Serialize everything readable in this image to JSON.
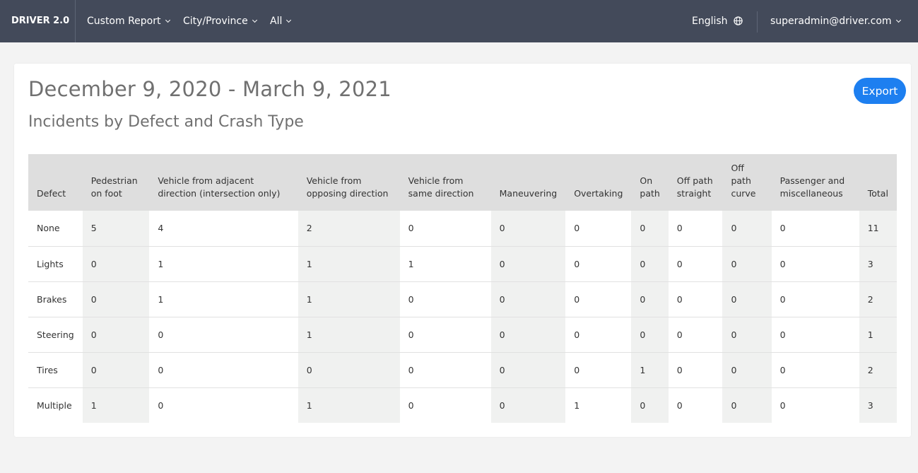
{
  "nav": {
    "brand": "DRIVER 2.0",
    "custom_report": "Custom Report",
    "city_province": "City/Province",
    "all": "All",
    "language": "English",
    "user": "superadmin@driver.com"
  },
  "report": {
    "date_range": "December 9, 2020 - March 9, 2021",
    "title": "Incidents by Defect and Crash Type",
    "export_label": "Export"
  },
  "table": {
    "headers": [
      "Defect",
      "Pedestrian on foot",
      "Vehicle from adjacent direction (intersection only)",
      "Vehicle from opposing direction",
      "Vehicle from same direction",
      "Maneuvering",
      "Overtaking",
      "On path",
      "Off path straight",
      "Off path curve",
      "Passenger and miscellaneous",
      "Total"
    ],
    "rows": [
      [
        "None",
        "5",
        "4",
        "2",
        "0",
        "0",
        "0",
        "0",
        "0",
        "0",
        "0",
        "11"
      ],
      [
        "Lights",
        "0",
        "1",
        "1",
        "1",
        "0",
        "0",
        "0",
        "0",
        "0",
        "0",
        "3"
      ],
      [
        "Brakes",
        "0",
        "1",
        "1",
        "0",
        "0",
        "0",
        "0",
        "0",
        "0",
        "0",
        "2"
      ],
      [
        "Steering",
        "0",
        "0",
        "1",
        "0",
        "0",
        "0",
        "0",
        "0",
        "0",
        "0",
        "1"
      ],
      [
        "Tires",
        "0",
        "0",
        "0",
        "0",
        "0",
        "0",
        "1",
        "0",
        "0",
        "0",
        "2"
      ],
      [
        "Multiple",
        "1",
        "0",
        "1",
        "0",
        "0",
        "1",
        "0",
        "0",
        "0",
        "0",
        "3"
      ]
    ]
  },
  "colors": {
    "topbar": "#434a5a",
    "accent": "#1d7ff0",
    "header_bg": "#dedede",
    "shaded_column": "#f0f1f0"
  }
}
